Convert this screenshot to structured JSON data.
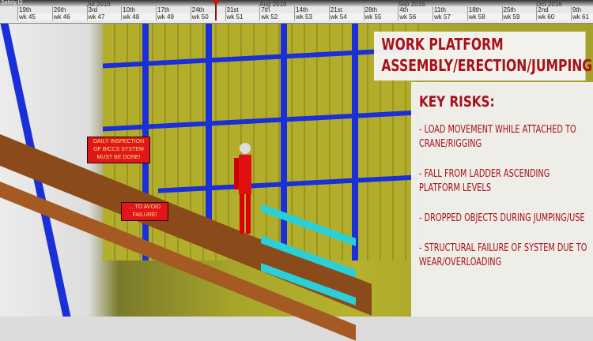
{
  "timeline": {
    "title": "Safety f2",
    "months": [
      "Jul 2016",
      "Aug 2016",
      "Sep 2016",
      "Oct 2016"
    ],
    "days": [
      "19th",
      "26th",
      "3rd",
      "10th",
      "17th",
      "24th",
      "31st",
      "7th",
      "14th",
      "21st",
      "28th",
      "4th",
      "11th",
      "18th",
      "25th",
      "2nd",
      "9th"
    ],
    "weeks": [
      "wk 45",
      "wk 46",
      "wk 47",
      "wk 48",
      "wk 49",
      "wk 50",
      "wk 51",
      "wk 52",
      "wk 53",
      "wk 54",
      "wk 55",
      "wk 56",
      "wk 57",
      "wk 58",
      "wk 59",
      "wk 60",
      "wk 61"
    ]
  },
  "notes": {
    "inspection": "DAILY INSPECTION OF BICCS SYSTEM MUST BE DONE!",
    "avoid": "... TO AVOID FAILURE!"
  },
  "panel": {
    "title_line1": "WORK PLATFORM",
    "title_line2": "ASSEMBLY/ERECTION/JUMPING",
    "risks_heading": "KEY RISKS:",
    "risks": [
      "- LOAD MOVEMENT WHILE ATTACHED TO CRANE/RIGGING",
      "- FALL FROM LADDER ASCENDING PLATFORM LEVELS",
      "- DROPPED OBJECTS DURING JUMPING/USE",
      "- STRUCTURAL FAILURE OF SYSTEM DUE TO WEAR/OVERLOADING"
    ]
  }
}
